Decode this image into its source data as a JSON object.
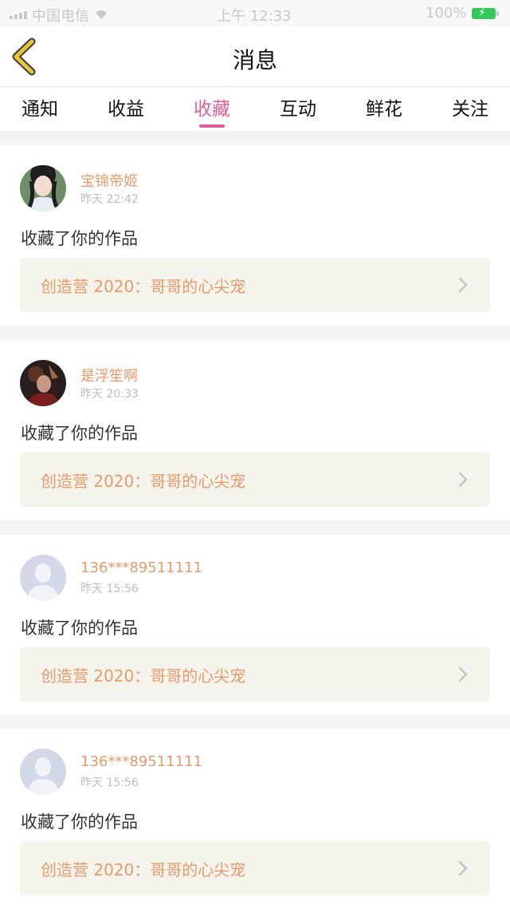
{
  "status_bar": {
    "carrier": "中国电信",
    "time": "上午 12:33",
    "battery": "100%"
  },
  "header": {
    "title": "消息",
    "back_icon": "chevron-left-icon",
    "accent_color": "#e8c43a"
  },
  "tabs": [
    {
      "label": "通知",
      "active": false
    },
    {
      "label": "收益",
      "active": false
    },
    {
      "label": "收藏",
      "active": true
    },
    {
      "label": "互动",
      "active": false
    },
    {
      "label": "鲜花",
      "active": false
    },
    {
      "label": "关注",
      "active": false
    }
  ],
  "active_color": "#e0609a",
  "notifications": [
    {
      "user": "宝锦帝姬",
      "time": "昨天 22:42",
      "action": "收藏了你的作品",
      "work": "创造营 2020：哥哥的心尖宠",
      "avatar": "photo-avatar-1"
    },
    {
      "user": "是浮笙啊",
      "time": "昨天 20:33",
      "action": "收藏了你的作品",
      "work": "创造营 2020：哥哥的心尖宠",
      "avatar": "photo-avatar-2"
    },
    {
      "user": "136***89511111",
      "time": "昨天 15:56",
      "action": "收藏了你的作品",
      "work": "创造营 2020：哥哥的心尖宠",
      "avatar": "default-avatar"
    },
    {
      "user": "136***89511111",
      "time": "昨天 15:56",
      "action": "收藏了你的作品",
      "work": "创造营 2020：哥哥的心尖宠",
      "avatar": "default-avatar"
    }
  ]
}
